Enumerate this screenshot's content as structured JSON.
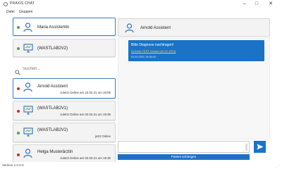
{
  "window": {
    "title": "PRAXIS CHAT",
    "minimize_icon": "minimize-icon",
    "maximize_icon": "maximize-icon",
    "close_icon": "close-icon"
  },
  "menu": [
    "Datei",
    "Gruppen"
  ],
  "contacts_top": [
    {
      "name": "Maria Assistentin",
      "status_color": "green",
      "icon": "user-icon",
      "selected": true,
      "status_text": ""
    },
    {
      "name": "(WASTLAB2V2)",
      "status_color": "green",
      "icon": "monitor-icon",
      "selected": false,
      "status_text": ""
    }
  ],
  "search": {
    "placeholder": "Suchen..."
  },
  "contacts": [
    {
      "name": "Arnold Assistent",
      "status_color": "red",
      "icon": "user-icon",
      "selected": true,
      "status_text": "zuletzt Online am 22.02.21 um 18:06"
    },
    {
      "name": "(WASTLAB2V1)",
      "status_color": "red",
      "icon": "monitor-icon",
      "selected": false,
      "status_text": "zuletzt Online am 02.03.21 um 19:35"
    },
    {
      "name": "(WASTLAB2V2)",
      "status_color": "green",
      "icon": "monitor-icon",
      "selected": false,
      "status_text": "jetzt Online"
    },
    {
      "name": "Helga Musterärztin",
      "status_color": "red",
      "icon": "user-icon",
      "selected": false,
      "status_text": "zuletzt Online am 02.03.21 um 19:35"
    }
  ],
  "chat": {
    "header_name": "Arnold Assistent",
    "messages": [
      {
        "title": "Bitte Diagnose nachtragen!",
        "link": "Dr.Kode TEST Vorand (10.12.1974)",
        "time": "02.03.2021 15:06:09"
      }
    ],
    "attach_label": "Patient anhängen",
    "send_icon": "send-icon"
  },
  "status": {
    "version": "Version 1.0.0.0"
  },
  "colors": {
    "accent": "#1a73c6",
    "online": "#4aa64a",
    "offline": "#d9262b",
    "link": "#f2d64a"
  }
}
